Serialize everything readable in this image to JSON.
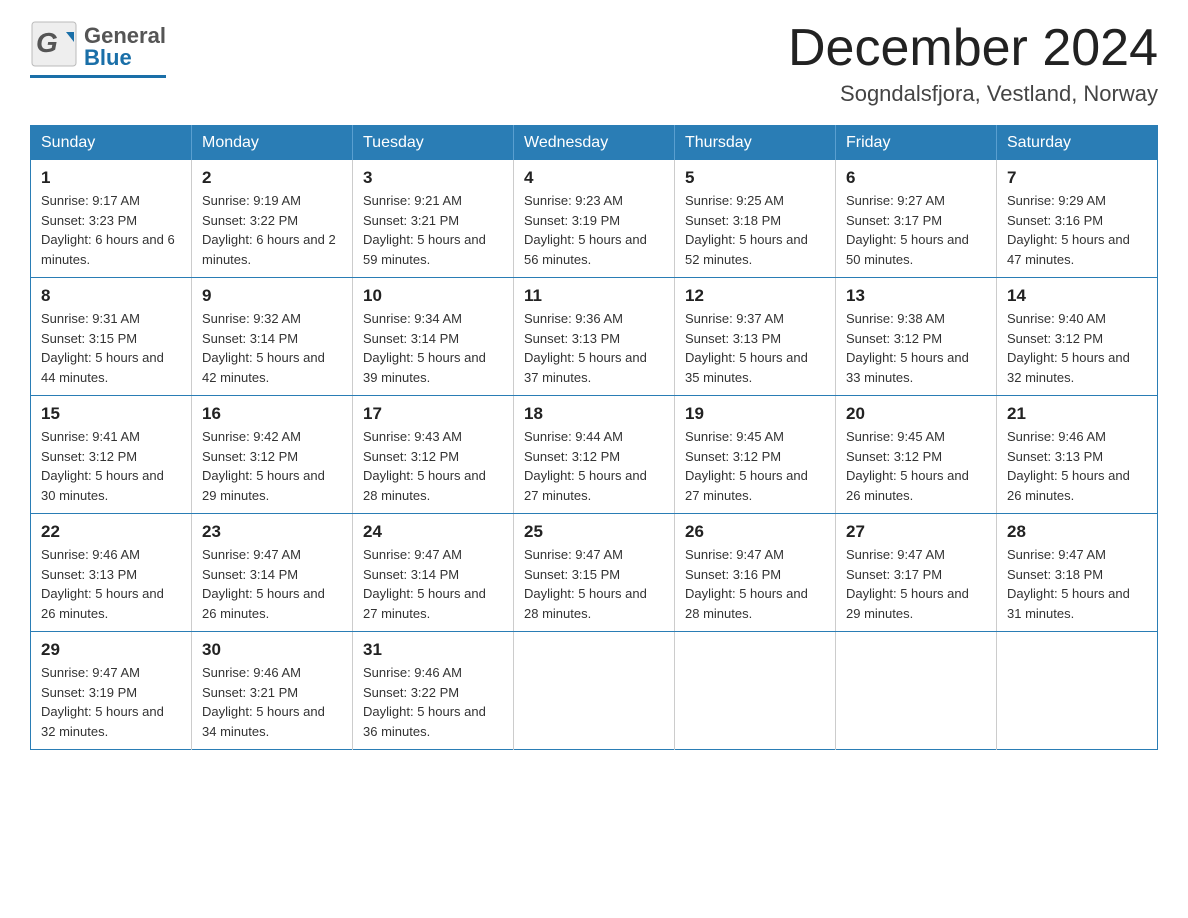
{
  "header": {
    "logo_general": "General",
    "logo_blue": "Blue",
    "month_title": "December 2024",
    "location": "Sogndalsfjora, Vestland, Norway"
  },
  "days_of_week": [
    "Sunday",
    "Monday",
    "Tuesday",
    "Wednesday",
    "Thursday",
    "Friday",
    "Saturday"
  ],
  "weeks": [
    [
      {
        "day": "1",
        "sunrise": "Sunrise: 9:17 AM",
        "sunset": "Sunset: 3:23 PM",
        "daylight": "Daylight: 6 hours and 6 minutes."
      },
      {
        "day": "2",
        "sunrise": "Sunrise: 9:19 AM",
        "sunset": "Sunset: 3:22 PM",
        "daylight": "Daylight: 6 hours and 2 minutes."
      },
      {
        "day": "3",
        "sunrise": "Sunrise: 9:21 AM",
        "sunset": "Sunset: 3:21 PM",
        "daylight": "Daylight: 5 hours and 59 minutes."
      },
      {
        "day": "4",
        "sunrise": "Sunrise: 9:23 AM",
        "sunset": "Sunset: 3:19 PM",
        "daylight": "Daylight: 5 hours and 56 minutes."
      },
      {
        "day": "5",
        "sunrise": "Sunrise: 9:25 AM",
        "sunset": "Sunset: 3:18 PM",
        "daylight": "Daylight: 5 hours and 52 minutes."
      },
      {
        "day": "6",
        "sunrise": "Sunrise: 9:27 AM",
        "sunset": "Sunset: 3:17 PM",
        "daylight": "Daylight: 5 hours and 50 minutes."
      },
      {
        "day": "7",
        "sunrise": "Sunrise: 9:29 AM",
        "sunset": "Sunset: 3:16 PM",
        "daylight": "Daylight: 5 hours and 47 minutes."
      }
    ],
    [
      {
        "day": "8",
        "sunrise": "Sunrise: 9:31 AM",
        "sunset": "Sunset: 3:15 PM",
        "daylight": "Daylight: 5 hours and 44 minutes."
      },
      {
        "day": "9",
        "sunrise": "Sunrise: 9:32 AM",
        "sunset": "Sunset: 3:14 PM",
        "daylight": "Daylight: 5 hours and 42 minutes."
      },
      {
        "day": "10",
        "sunrise": "Sunrise: 9:34 AM",
        "sunset": "Sunset: 3:14 PM",
        "daylight": "Daylight: 5 hours and 39 minutes."
      },
      {
        "day": "11",
        "sunrise": "Sunrise: 9:36 AM",
        "sunset": "Sunset: 3:13 PM",
        "daylight": "Daylight: 5 hours and 37 minutes."
      },
      {
        "day": "12",
        "sunrise": "Sunrise: 9:37 AM",
        "sunset": "Sunset: 3:13 PM",
        "daylight": "Daylight: 5 hours and 35 minutes."
      },
      {
        "day": "13",
        "sunrise": "Sunrise: 9:38 AM",
        "sunset": "Sunset: 3:12 PM",
        "daylight": "Daylight: 5 hours and 33 minutes."
      },
      {
        "day": "14",
        "sunrise": "Sunrise: 9:40 AM",
        "sunset": "Sunset: 3:12 PM",
        "daylight": "Daylight: 5 hours and 32 minutes."
      }
    ],
    [
      {
        "day": "15",
        "sunrise": "Sunrise: 9:41 AM",
        "sunset": "Sunset: 3:12 PM",
        "daylight": "Daylight: 5 hours and 30 minutes."
      },
      {
        "day": "16",
        "sunrise": "Sunrise: 9:42 AM",
        "sunset": "Sunset: 3:12 PM",
        "daylight": "Daylight: 5 hours and 29 minutes."
      },
      {
        "day": "17",
        "sunrise": "Sunrise: 9:43 AM",
        "sunset": "Sunset: 3:12 PM",
        "daylight": "Daylight: 5 hours and 28 minutes."
      },
      {
        "day": "18",
        "sunrise": "Sunrise: 9:44 AM",
        "sunset": "Sunset: 3:12 PM",
        "daylight": "Daylight: 5 hours and 27 minutes."
      },
      {
        "day": "19",
        "sunrise": "Sunrise: 9:45 AM",
        "sunset": "Sunset: 3:12 PM",
        "daylight": "Daylight: 5 hours and 27 minutes."
      },
      {
        "day": "20",
        "sunrise": "Sunrise: 9:45 AM",
        "sunset": "Sunset: 3:12 PM",
        "daylight": "Daylight: 5 hours and 26 minutes."
      },
      {
        "day": "21",
        "sunrise": "Sunrise: 9:46 AM",
        "sunset": "Sunset: 3:13 PM",
        "daylight": "Daylight: 5 hours and 26 minutes."
      }
    ],
    [
      {
        "day": "22",
        "sunrise": "Sunrise: 9:46 AM",
        "sunset": "Sunset: 3:13 PM",
        "daylight": "Daylight: 5 hours and 26 minutes."
      },
      {
        "day": "23",
        "sunrise": "Sunrise: 9:47 AM",
        "sunset": "Sunset: 3:14 PM",
        "daylight": "Daylight: 5 hours and 26 minutes."
      },
      {
        "day": "24",
        "sunrise": "Sunrise: 9:47 AM",
        "sunset": "Sunset: 3:14 PM",
        "daylight": "Daylight: 5 hours and 27 minutes."
      },
      {
        "day": "25",
        "sunrise": "Sunrise: 9:47 AM",
        "sunset": "Sunset: 3:15 PM",
        "daylight": "Daylight: 5 hours and 28 minutes."
      },
      {
        "day": "26",
        "sunrise": "Sunrise: 9:47 AM",
        "sunset": "Sunset: 3:16 PM",
        "daylight": "Daylight: 5 hours and 28 minutes."
      },
      {
        "day": "27",
        "sunrise": "Sunrise: 9:47 AM",
        "sunset": "Sunset: 3:17 PM",
        "daylight": "Daylight: 5 hours and 29 minutes."
      },
      {
        "day": "28",
        "sunrise": "Sunrise: 9:47 AM",
        "sunset": "Sunset: 3:18 PM",
        "daylight": "Daylight: 5 hours and 31 minutes."
      }
    ],
    [
      {
        "day": "29",
        "sunrise": "Sunrise: 9:47 AM",
        "sunset": "Sunset: 3:19 PM",
        "daylight": "Daylight: 5 hours and 32 minutes."
      },
      {
        "day": "30",
        "sunrise": "Sunrise: 9:46 AM",
        "sunset": "Sunset: 3:21 PM",
        "daylight": "Daylight: 5 hours and 34 minutes."
      },
      {
        "day": "31",
        "sunrise": "Sunrise: 9:46 AM",
        "sunset": "Sunset: 3:22 PM",
        "daylight": "Daylight: 5 hours and 36 minutes."
      },
      null,
      null,
      null,
      null
    ]
  ]
}
